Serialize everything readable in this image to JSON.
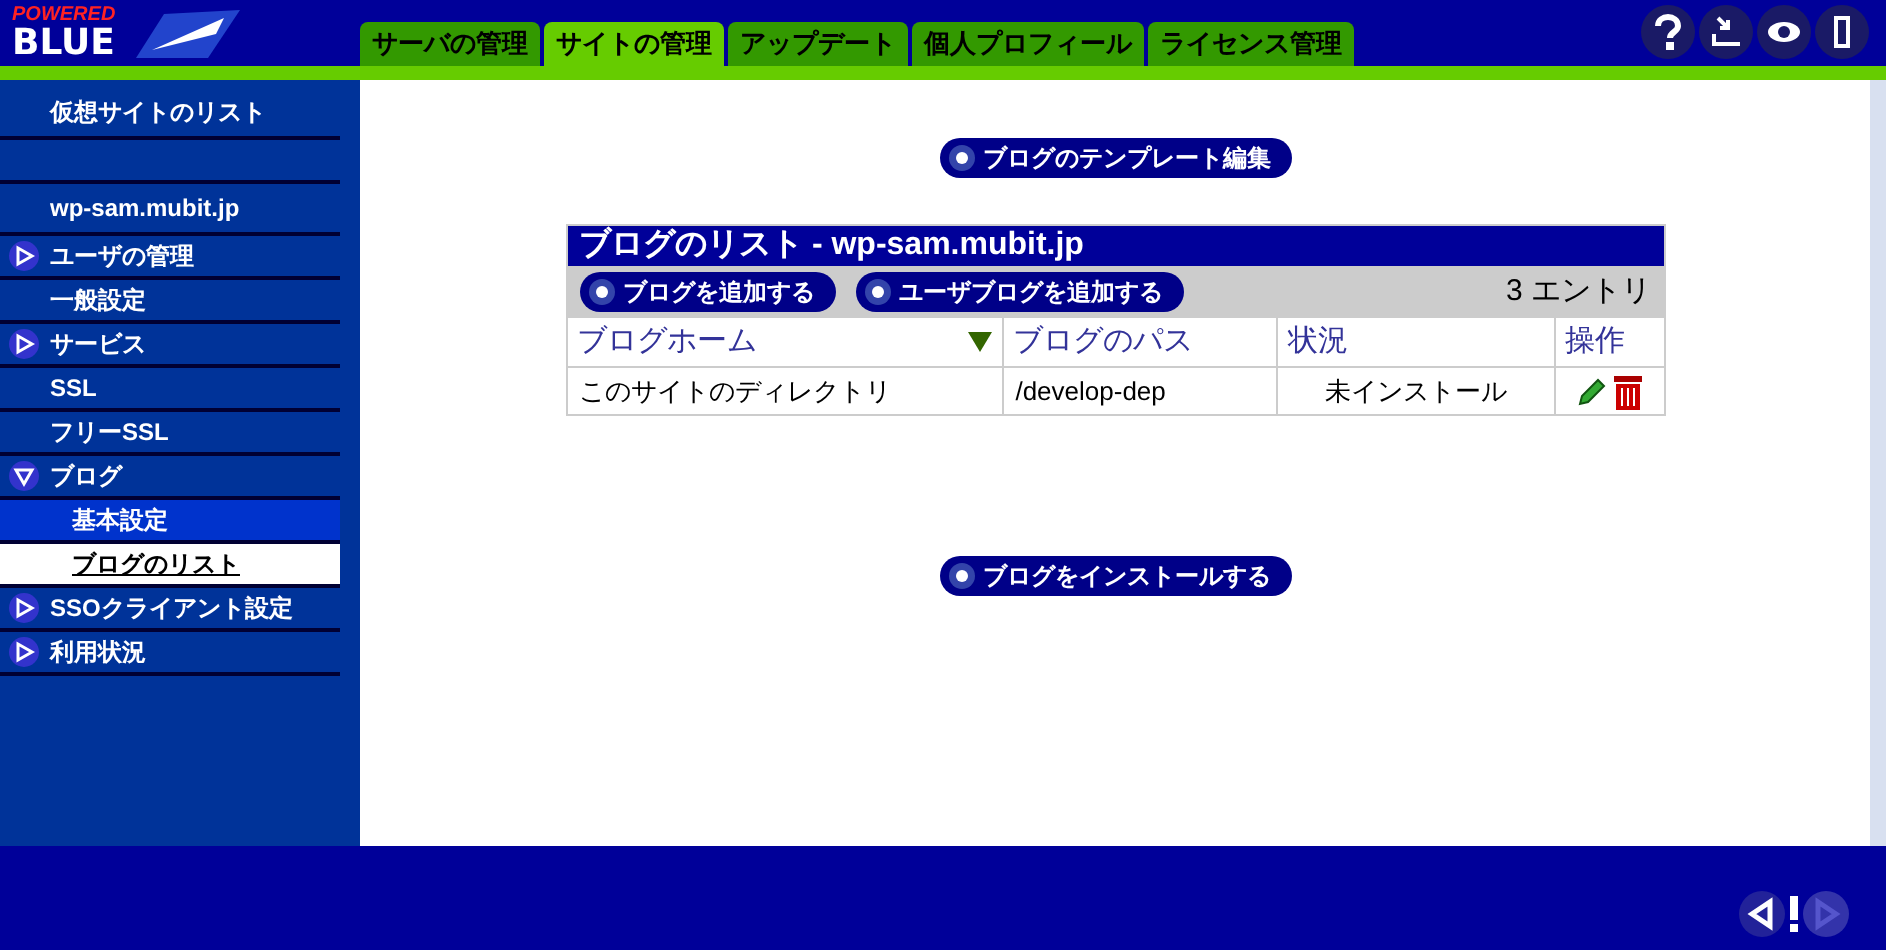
{
  "logo": {
    "top": "POWERED",
    "bottom": "BLUE"
  },
  "tabs": [
    {
      "label": "サーバの管理",
      "selected": false
    },
    {
      "label": "サイトの管理",
      "selected": true
    },
    {
      "label": "アップデート",
      "selected": false
    },
    {
      "label": "個人プロフィール",
      "selected": false
    },
    {
      "label": "ライセンス管理",
      "selected": false
    }
  ],
  "header_icons": [
    {
      "kind": "help"
    },
    {
      "kind": "tray"
    },
    {
      "kind": "eye"
    },
    {
      "kind": "door"
    }
  ],
  "sidebar": {
    "items": [
      {
        "kind": "title",
        "label": "仮想サイトのリスト"
      },
      {
        "kind": "blank"
      },
      {
        "kind": "title",
        "label": "wp-sam.mubit.jp"
      },
      {
        "kind": "group",
        "label": "ユーザの管理",
        "expanded": false
      },
      {
        "kind": "plain",
        "label": "一般設定"
      },
      {
        "kind": "group",
        "label": "サービス",
        "expanded": false
      },
      {
        "kind": "plain",
        "label": "SSL"
      },
      {
        "kind": "plain",
        "label": "フリーSSL"
      },
      {
        "kind": "group",
        "label": "ブログ",
        "expanded": true,
        "children": [
          {
            "label": "基本設定",
            "selected": false
          },
          {
            "label": "ブログのリスト",
            "selected": true
          }
        ]
      },
      {
        "kind": "group",
        "label": "SSOクライアント設定",
        "expanded": false
      },
      {
        "kind": "group",
        "label": "利用状況",
        "expanded": false
      }
    ]
  },
  "top_button": "ブログのテンプレート編集",
  "table": {
    "title": "ブログのリスト - wp-sam.mubit.jp",
    "buttons": [
      "ブログを追加する",
      "ユーザブログを追加する"
    ],
    "count": "3 エントリ",
    "columns": [
      {
        "label": "ブログホーム",
        "sorted": true
      },
      {
        "label": "ブログのパス",
        "sorted": false
      },
      {
        "label": "状況",
        "sorted": false
      },
      {
        "label": "操作",
        "sorted": false
      }
    ],
    "rows": [
      {
        "home": "このサイトのディレクトリ",
        "path": "/develop-dep",
        "status": "未インストール"
      }
    ]
  },
  "bottom_button": "ブログをインストールする",
  "footer": {
    "buttons": [
      {
        "kind": "back",
        "disabled": false
      },
      {
        "kind": "alert",
        "disabled": false
      },
      {
        "kind": "forward",
        "disabled": true
      }
    ]
  }
}
